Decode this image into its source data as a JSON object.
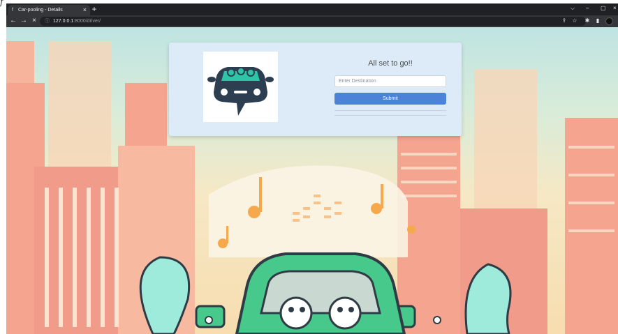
{
  "browser": {
    "edge_glyph": "f",
    "tab": {
      "favicon": "f",
      "title": "Car-pooling - Details",
      "close_glyph": "×"
    },
    "new_tab_glyph": "+",
    "window_controls": {
      "minimize": "–",
      "maximize": "▢",
      "close": "×",
      "tab_search": "⌵"
    },
    "nav": {
      "back": "←",
      "forward": "→",
      "stop": "×"
    },
    "address": {
      "info_glyph": "ⓘ",
      "host": "127.0.0.1",
      "rest": ":8000/driver/"
    },
    "toolbar_icons": {
      "share": "⇪",
      "bookmark": "☆",
      "extensions": "✱",
      "side_panel": "▮"
    }
  },
  "card": {
    "logo_icon": "carpool-logo-icon",
    "title": "All set to go!!",
    "destination_placeholder": "Enter Destination",
    "destination_value": "",
    "submit_label": "Submit"
  },
  "colors": {
    "card_bg": "#dcebf7",
    "submit_bg": "#4c83d9",
    "car_body": "#46c98b",
    "buildings": "#f4a48f",
    "sky": "#bfe4e2"
  }
}
